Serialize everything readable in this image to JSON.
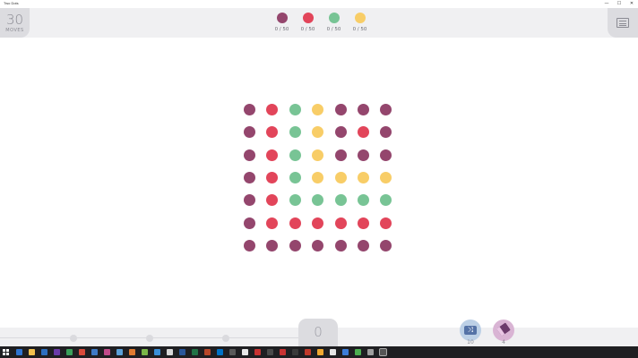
{
  "window": {
    "title": "Two Dots",
    "controls": [
      {
        "name": "minimize",
        "glyph": "—"
      },
      {
        "name": "maximize",
        "glyph": "☐"
      },
      {
        "name": "close",
        "glyph": "✕"
      }
    ]
  },
  "header": {
    "moves_count": "30",
    "moves_label": "MOVES",
    "goals": [
      {
        "color": "#94466d",
        "progress": "0 / 50"
      },
      {
        "color": "#e2455a",
        "progress": "0 / 50"
      },
      {
        "color": "#78c495",
        "progress": "0 / 50"
      },
      {
        "color": "#f8cd67",
        "progress": "0 / 50"
      }
    ],
    "menu_icon": "menu-icon"
  },
  "colors": {
    "P": "#94466d",
    "R": "#e2455a",
    "G": "#78c495",
    "Y": "#f8cd67"
  },
  "board": {
    "rows": [
      [
        "P",
        "R",
        "G",
        "Y",
        "P",
        "P",
        "P"
      ],
      [
        "P",
        "R",
        "G",
        "Y",
        "P",
        "R",
        "P"
      ],
      [
        "P",
        "R",
        "G",
        "Y",
        "P",
        "P",
        "P"
      ],
      [
        "P",
        "R",
        "G",
        "Y",
        "Y",
        "Y",
        "Y"
      ],
      [
        "P",
        "R",
        "G",
        "G",
        "G",
        "G",
        "G"
      ],
      [
        "P",
        "R",
        "R",
        "R",
        "R",
        "R",
        "R"
      ],
      [
        "P",
        "P",
        "P",
        "P",
        "P",
        "P",
        "P"
      ]
    ]
  },
  "footer": {
    "score": "0",
    "level_progress": 0,
    "powerups": [
      {
        "name": "shrinker",
        "icon": "shrink-icon",
        "count": "10",
        "color": "#bcd0e6"
      },
      {
        "name": "eraser",
        "icon": "eraser-icon",
        "count": "4",
        "color": "#d9b4d4"
      }
    ]
  }
}
